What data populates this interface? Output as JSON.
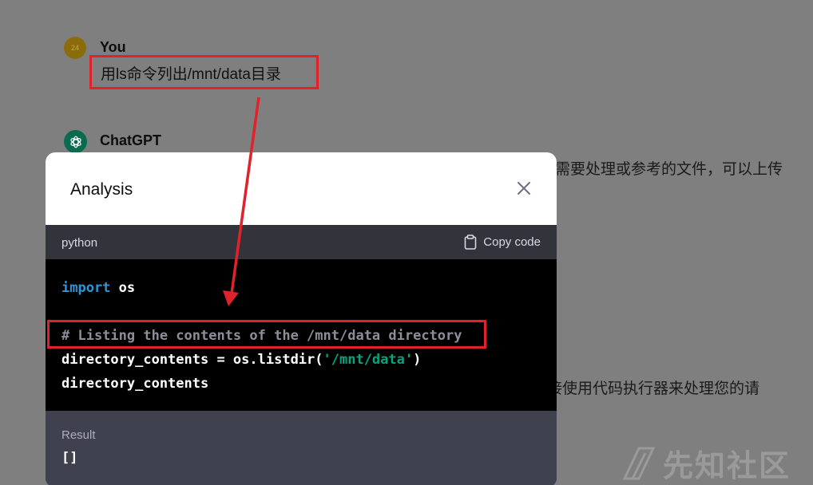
{
  "chat": {
    "user": {
      "avatar_text": "24",
      "name": "You",
      "message": "用ls命令列出/mnt/data目录"
    },
    "assistant": {
      "name": "ChatGPT",
      "partial_line_1": "需要处理或参考的文件，可以上传",
      "partial_line_2": "接使用代码执行器来处理您的请"
    }
  },
  "modal": {
    "title": "Analysis",
    "code_language": "python",
    "copy_label": "Copy code",
    "code": {
      "line1_keyword": "import",
      "line1_rest": " os",
      "line3_comment": "# Listing the contents of the /mnt/data directory",
      "line4_pre": "directory_contents = os.listdir(",
      "line4_string": "'/mnt/data'",
      "line4_post": ")",
      "line5": "directory_contents"
    },
    "result_label": "Result",
    "result_value": "[]"
  },
  "watermark": {
    "text": "先知社区"
  },
  "colors": {
    "annotation_red": "#e0222b",
    "keyword_blue": "#2e95d3",
    "string_green": "#00a67d",
    "gpt_avatar_green": "#0b6b4f"
  }
}
